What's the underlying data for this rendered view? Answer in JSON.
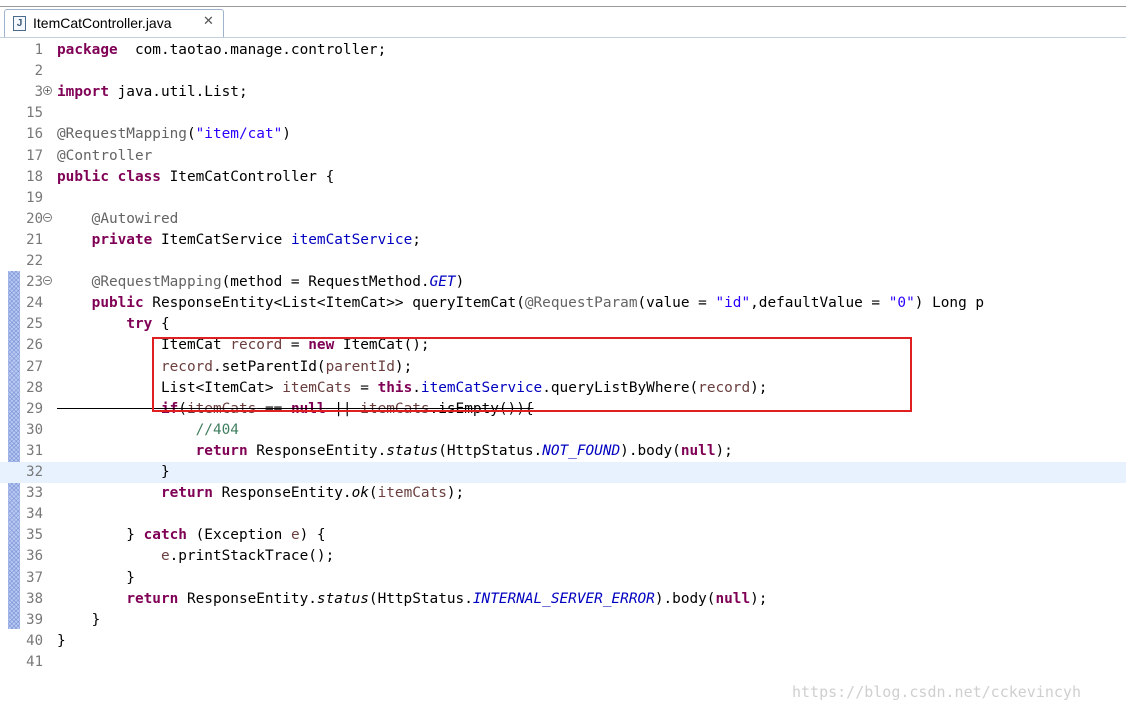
{
  "tab": {
    "icon": "java-file-icon",
    "icon_glyph": "J",
    "title": "ItemCatController.java",
    "close_glyph": "✕"
  },
  "lines": [
    {
      "n": "1",
      "segs": [
        [
          "kw",
          "package"
        ],
        [
          "",
          "  com.taotao.manage.controller;"
        ]
      ]
    },
    {
      "n": "2",
      "segs": []
    },
    {
      "n": "3",
      "fold": "+",
      "segs": [
        [
          "kw",
          "import"
        ],
        [
          "",
          " java.util.List;"
        ]
      ]
    },
    {
      "n": "15",
      "segs": []
    },
    {
      "n": "16",
      "segs": [
        [
          "ann",
          "@RequestMapping"
        ],
        [
          "",
          "("
        ],
        [
          "str",
          "\"item/cat\""
        ],
        [
          "",
          ")"
        ]
      ]
    },
    {
      "n": "17",
      "segs": [
        [
          "ann",
          "@Controller"
        ]
      ]
    },
    {
      "n": "18",
      "segs": [
        [
          "kw",
          "public"
        ],
        [
          "",
          " "
        ],
        [
          "kw",
          "class"
        ],
        [
          "",
          " ItemCatController {"
        ]
      ]
    },
    {
      "n": "19",
      "segs": []
    },
    {
      "n": "20",
      "fold": "-",
      "segs": [
        [
          "",
          "    "
        ],
        [
          "ann",
          "@Autowired"
        ]
      ]
    },
    {
      "n": "21",
      "segs": [
        [
          "",
          "    "
        ],
        [
          "kw",
          "private"
        ],
        [
          "",
          " ItemCatService "
        ],
        [
          "fld",
          "itemCatService"
        ],
        [
          "",
          ";"
        ]
      ]
    },
    {
      "n": "22",
      "segs": []
    },
    {
      "n": "23",
      "fold": "-",
      "segs": [
        [
          "",
          "    "
        ],
        [
          "ann",
          "@RequestMapping"
        ],
        [
          "",
          "(method = RequestMethod."
        ],
        [
          "sfld",
          "GET"
        ],
        [
          "",
          ")"
        ]
      ]
    },
    {
      "n": "24",
      "segs": [
        [
          "",
          "    "
        ],
        [
          "kw",
          "public"
        ],
        [
          "",
          " ResponseEntity<List<ItemCat>> queryItemCat("
        ],
        [
          "ann",
          "@RequestParam"
        ],
        [
          "",
          "(value = "
        ],
        [
          "str",
          "\"id\""
        ],
        [
          "",
          ",defaultValue = "
        ],
        [
          "str",
          "\"0\""
        ],
        [
          "",
          ") Long p"
        ]
      ]
    },
    {
      "n": "25",
      "segs": [
        [
          "",
          "        "
        ],
        [
          "kw",
          "try"
        ],
        [
          "",
          " {"
        ]
      ]
    },
    {
      "n": "26",
      "segs": [
        [
          "",
          "            ItemCat "
        ],
        [
          "lv",
          "record"
        ],
        [
          "",
          " = "
        ],
        [
          "kw",
          "new"
        ],
        [
          "",
          " ItemCat();"
        ]
      ]
    },
    {
      "n": "27",
      "segs": [
        [
          "",
          "            "
        ],
        [
          "lv",
          "record"
        ],
        [
          "",
          ".setParentId("
        ],
        [
          "lv",
          "parentId"
        ],
        [
          "",
          ");"
        ]
      ]
    },
    {
      "n": "28",
      "segs": [
        [
          "",
          "            List<ItemCat> "
        ],
        [
          "lv",
          "itemCats"
        ],
        [
          "",
          " = "
        ],
        [
          "kw",
          "this"
        ],
        [
          "",
          "."
        ],
        [
          "fld",
          "itemCatService"
        ],
        [
          "",
          ".queryListByWhere("
        ],
        [
          "lv",
          "record"
        ],
        [
          "",
          ");"
        ]
      ]
    },
    {
      "n": "29",
      "strike": true,
      "segs": [
        [
          "",
          "            "
        ],
        [
          "kw",
          "if"
        ],
        [
          "",
          "("
        ],
        [
          "lv",
          "itemCats"
        ],
        [
          "",
          " == "
        ],
        [
          "kw",
          "null"
        ],
        [
          "",
          " || "
        ],
        [
          "lv",
          "itemCats"
        ],
        [
          "",
          ".isEmpty()){"
        ]
      ]
    },
    {
      "n": "30",
      "segs": [
        [
          "",
          "                "
        ],
        [
          "cmt",
          "//404"
        ]
      ]
    },
    {
      "n": "31",
      "segs": [
        [
          "",
          "                "
        ],
        [
          "kw",
          "return"
        ],
        [
          "",
          " ResponseEntity."
        ],
        [
          "ital",
          "status"
        ],
        [
          "",
          "(HttpStatus."
        ],
        [
          "sfld",
          "NOT_FOUND"
        ],
        [
          "",
          ").body("
        ],
        [
          "kw",
          "null"
        ],
        [
          "",
          ");"
        ]
      ]
    },
    {
      "n": "32",
      "current": true,
      "segs": [
        [
          "",
          "            }"
        ]
      ]
    },
    {
      "n": "33",
      "segs": [
        [
          "",
          "            "
        ],
        [
          "kw",
          "return"
        ],
        [
          "",
          " ResponseEntity."
        ],
        [
          "ital",
          "ok"
        ],
        [
          "",
          "("
        ],
        [
          "lv",
          "itemCats"
        ],
        [
          "",
          ");"
        ]
      ]
    },
    {
      "n": "34",
      "segs": []
    },
    {
      "n": "35",
      "segs": [
        [
          "",
          "        } "
        ],
        [
          "kw",
          "catch"
        ],
        [
          "",
          " (Exception "
        ],
        [
          "lv",
          "e"
        ],
        [
          "",
          ") {"
        ]
      ]
    },
    {
      "n": "36",
      "segs": [
        [
          "",
          "            "
        ],
        [
          "lv",
          "e"
        ],
        [
          "",
          ".printStackTrace();"
        ]
      ]
    },
    {
      "n": "37",
      "segs": [
        [
          "",
          "        }"
        ]
      ]
    },
    {
      "n": "38",
      "segs": [
        [
          "",
          "        "
        ],
        [
          "kw",
          "return"
        ],
        [
          "",
          " ResponseEntity."
        ],
        [
          "ital",
          "status"
        ],
        [
          "",
          "(HttpStatus."
        ],
        [
          "sfld",
          "INTERNAL_SERVER_ERROR"
        ],
        [
          "",
          ").body("
        ],
        [
          "kw",
          "null"
        ],
        [
          "",
          ");"
        ]
      ]
    },
    {
      "n": "39",
      "segs": [
        [
          "",
          "    }"
        ]
      ]
    },
    {
      "n": "40",
      "segs": [
        [
          "",
          "}"
        ]
      ]
    },
    {
      "n": "41",
      "segs": []
    }
  ],
  "watermark": "https://blog.csdn.net/cckevincyh"
}
